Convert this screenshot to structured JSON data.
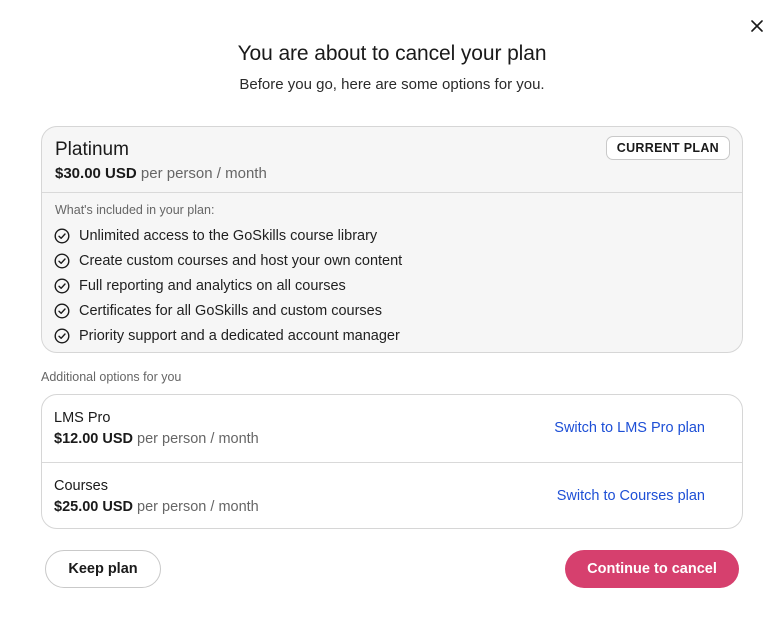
{
  "title": "You are about to cancel your plan",
  "subtitle": "Before you go, here are some options for you.",
  "current_plan": {
    "name": "Platinum",
    "price": "$30.00 USD",
    "unit": "per person / month",
    "badge": "CURRENT PLAN",
    "included_label": "What's included in your plan:",
    "features": [
      "Unlimited access to the GoSkills course library",
      "Create custom courses and host your own content",
      "Full reporting and analytics on all courses",
      "Certificates for all GoSkills and custom courses",
      "Priority support and a dedicated account manager"
    ]
  },
  "additional": {
    "label": "Additional options for you",
    "options": [
      {
        "name": "LMS Pro",
        "price": "$12.00 USD",
        "unit": "per person / month",
        "link": "Switch to LMS Pro plan"
      },
      {
        "name": "Courses",
        "price": "$25.00 USD",
        "unit": "per person / month",
        "link": "Switch to Courses plan"
      }
    ]
  },
  "buttons": {
    "keep": "Keep plan",
    "continue": "Continue to cancel"
  },
  "icons": {
    "close": "close-icon",
    "check": "check-circle-icon"
  },
  "colors": {
    "accent": "#d6406e",
    "link": "#1d4fd6"
  }
}
